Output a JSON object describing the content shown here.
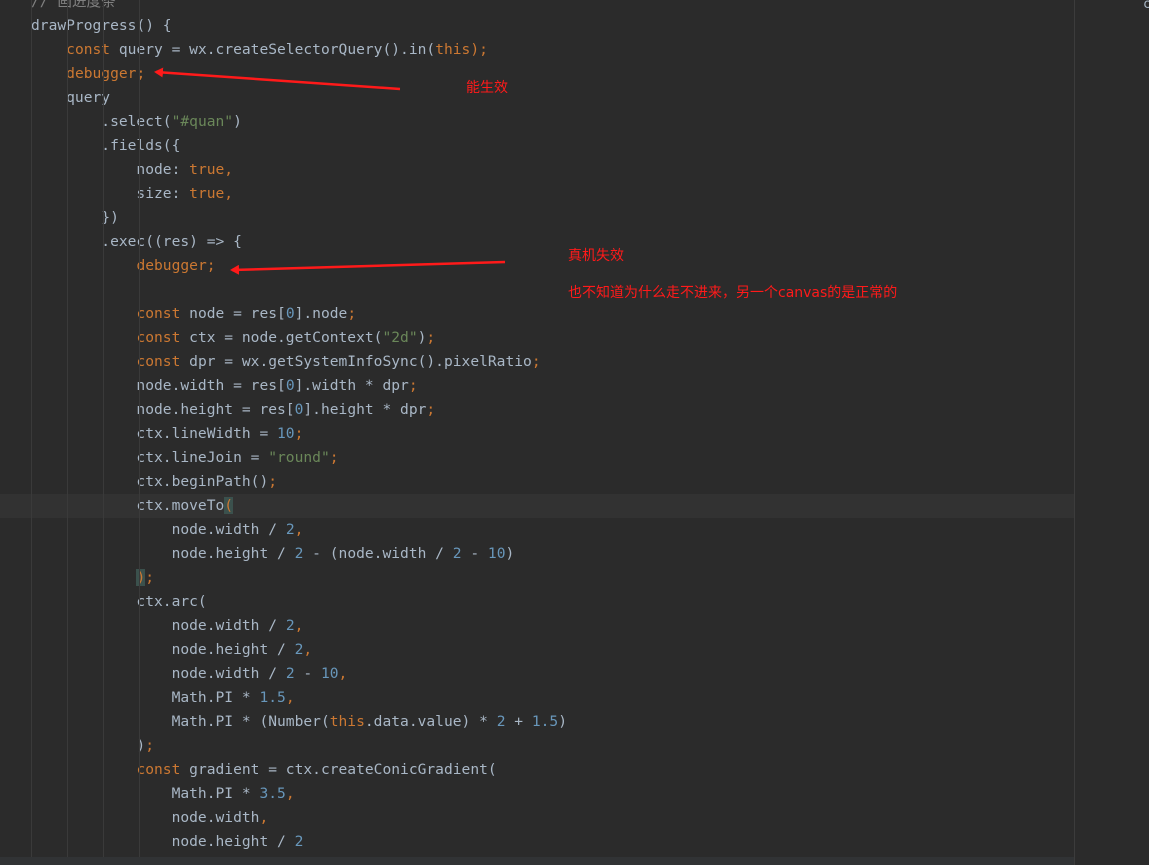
{
  "editor": {
    "lines": [
      [
        {
          "t": "// 画进度条",
          "c": "cmt"
        }
      ],
      [
        {
          "t": "drawProgress() {",
          "c": "plain"
        }
      ],
      [
        {
          "t": "    ",
          "c": "plain"
        },
        {
          "t": "const",
          "c": "kw"
        },
        {
          "t": " query = wx.createSelectorQuery().in(",
          "c": "plain"
        },
        {
          "t": "this",
          "c": "kw"
        },
        {
          "t": ");",
          "c": "kw"
        }
      ],
      [
        {
          "t": "    ",
          "c": "plain"
        },
        {
          "t": "debugger;",
          "c": "kw"
        }
      ],
      [
        {
          "t": "    query",
          "c": "plain"
        }
      ],
      [
        {
          "t": "        .select(",
          "c": "plain"
        },
        {
          "t": "\"#quan\"",
          "c": "str"
        },
        {
          "t": ")",
          "c": "plain"
        }
      ],
      [
        {
          "t": "        .fields({",
          "c": "plain"
        }
      ],
      [
        {
          "t": "            node: ",
          "c": "plain"
        },
        {
          "t": "true,",
          "c": "kw"
        }
      ],
      [
        {
          "t": "            size: ",
          "c": "plain"
        },
        {
          "t": "true,",
          "c": "kw"
        }
      ],
      [
        {
          "t": "        })",
          "c": "plain"
        }
      ],
      [
        {
          "t": "        .exec((res) => {",
          "c": "plain"
        }
      ],
      [
        {
          "t": "            ",
          "c": "plain"
        },
        {
          "t": "debugger;",
          "c": "kw"
        }
      ],
      [],
      [
        {
          "t": "            ",
          "c": "plain"
        },
        {
          "t": "const",
          "c": "kw"
        },
        {
          "t": " node = res[",
          "c": "plain"
        },
        {
          "t": "0",
          "c": "num"
        },
        {
          "t": "].node",
          "c": "plain"
        },
        {
          "t": ";",
          "c": "kw"
        }
      ],
      [
        {
          "t": "            ",
          "c": "plain"
        },
        {
          "t": "const",
          "c": "kw"
        },
        {
          "t": " ctx = node.getContext(",
          "c": "plain"
        },
        {
          "t": "\"2d\"",
          "c": "str"
        },
        {
          "t": ")",
          "c": "plain"
        },
        {
          "t": ";",
          "c": "kw"
        }
      ],
      [
        {
          "t": "            ",
          "c": "plain"
        },
        {
          "t": "const",
          "c": "kw"
        },
        {
          "t": " dpr = wx.getSystemInfoSync().pixelRatio",
          "c": "plain"
        },
        {
          "t": ";",
          "c": "kw"
        }
      ],
      [
        {
          "t": "            node.width = res[",
          "c": "plain"
        },
        {
          "t": "0",
          "c": "num"
        },
        {
          "t": "].width * dpr",
          "c": "plain"
        },
        {
          "t": ";",
          "c": "kw"
        }
      ],
      [
        {
          "t": "            node.height = res[",
          "c": "plain"
        },
        {
          "t": "0",
          "c": "num"
        },
        {
          "t": "].height * dpr",
          "c": "plain"
        },
        {
          "t": ";",
          "c": "kw"
        }
      ],
      [
        {
          "t": "            ctx.lineWidth = ",
          "c": "plain"
        },
        {
          "t": "10",
          "c": "num"
        },
        {
          "t": ";",
          "c": "kw"
        }
      ],
      [
        {
          "t": "            ctx.lineJoin = ",
          "c": "plain"
        },
        {
          "t": "\"round\"",
          "c": "str"
        },
        {
          "t": ";",
          "c": "kw"
        }
      ],
      [
        {
          "t": "            ctx.beginPath()",
          "c": "plain"
        },
        {
          "t": ";",
          "c": "kw"
        }
      ],
      [
        {
          "t": "            ctx.moveTo",
          "c": "plain"
        },
        {
          "t": "(",
          "c": "kw",
          "hl": true
        }
      ],
      [
        {
          "t": "                node.width / ",
          "c": "plain"
        },
        {
          "t": "2",
          "c": "num"
        },
        {
          "t": ",",
          "c": "kw"
        }
      ],
      [
        {
          "t": "                node.height / ",
          "c": "plain"
        },
        {
          "t": "2",
          "c": "num"
        },
        {
          "t": " - (node.width / ",
          "c": "plain"
        },
        {
          "t": "2",
          "c": "num"
        },
        {
          "t": " - ",
          "c": "plain"
        },
        {
          "t": "10",
          "c": "num"
        },
        {
          "t": ")",
          "c": "plain"
        }
      ],
      [
        {
          "t": "            ",
          "c": "plain"
        },
        {
          "t": ")",
          "c": "kw",
          "hl": true
        },
        {
          "t": ";",
          "c": "kw"
        }
      ],
      [
        {
          "t": "            ctx.arc(",
          "c": "plain"
        }
      ],
      [
        {
          "t": "                node.width / ",
          "c": "plain"
        },
        {
          "t": "2",
          "c": "num"
        },
        {
          "t": ",",
          "c": "kw"
        }
      ],
      [
        {
          "t": "                node.height / ",
          "c": "plain"
        },
        {
          "t": "2",
          "c": "num"
        },
        {
          "t": ",",
          "c": "kw"
        }
      ],
      [
        {
          "t": "                node.width / ",
          "c": "plain"
        },
        {
          "t": "2",
          "c": "num"
        },
        {
          "t": " - ",
          "c": "plain"
        },
        {
          "t": "10",
          "c": "num"
        },
        {
          "t": ",",
          "c": "kw"
        }
      ],
      [
        {
          "t": "                Math.PI * ",
          "c": "plain"
        },
        {
          "t": "1.5",
          "c": "num"
        },
        {
          "t": ",",
          "c": "kw"
        }
      ],
      [
        {
          "t": "                Math.PI * (Number(",
          "c": "plain"
        },
        {
          "t": "this",
          "c": "kw"
        },
        {
          "t": ".data.value) * ",
          "c": "plain"
        },
        {
          "t": "2",
          "c": "num"
        },
        {
          "t": " + ",
          "c": "plain"
        },
        {
          "t": "1.5",
          "c": "num"
        },
        {
          "t": ")",
          "c": "plain"
        }
      ],
      [
        {
          "t": "            )",
          "c": "plain"
        },
        {
          "t": ";",
          "c": "kw"
        }
      ],
      [
        {
          "t": "            ",
          "c": "plain"
        },
        {
          "t": "const",
          "c": "kw"
        },
        {
          "t": " gradient = ctx.createConicGradient(",
          "c": "plain"
        }
      ],
      [
        {
          "t": "                Math.PI * ",
          "c": "plain"
        },
        {
          "t": "3.5",
          "c": "num"
        },
        {
          "t": ",",
          "c": "kw"
        }
      ],
      [
        {
          "t": "                node.width",
          "c": "plain"
        },
        {
          "t": ",",
          "c": "kw"
        }
      ],
      [
        {
          "t": "                node.height / ",
          "c": "plain"
        },
        {
          "t": "2",
          "c": "num"
        }
      ]
    ],
    "current_line": 21,
    "edge_char": "c"
  },
  "annotations": {
    "works": "能生效",
    "fails_on_device": "真机失效",
    "explanation": "也不知道为什么走不进来，另一个canvas的是正常的"
  },
  "colors": {
    "background": "#2b2b2b",
    "keyword": "#cc7832",
    "string": "#6a8759",
    "number": "#6897bb",
    "text": "#a9b7c6",
    "comment": "#808080",
    "annotation_red": "#ff1a1a"
  }
}
